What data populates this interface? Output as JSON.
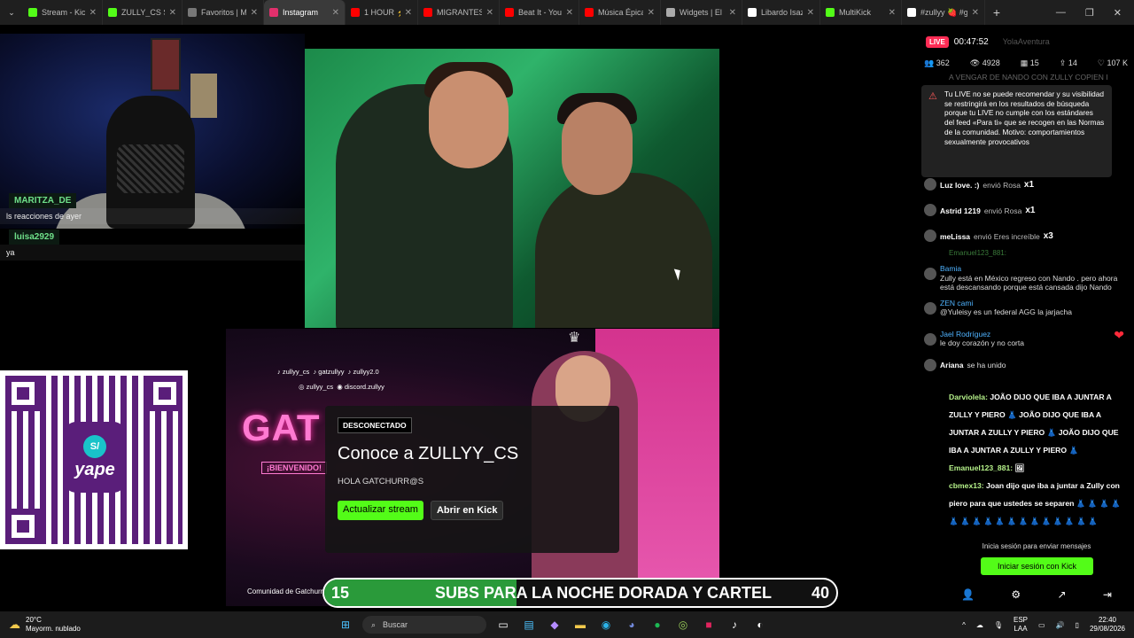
{
  "browser": {
    "tabs": [
      {
        "label": "Stream - Kick | (",
        "color": "#53fc18"
      },
      {
        "label": "ZULLY_CS Strea",
        "color": "#53fc18"
      },
      {
        "label": "Favoritos | My",
        "color": "#777777"
      },
      {
        "label": "Instagram",
        "color": "#e1306c",
        "active": true
      },
      {
        "label": "1 HOUR ⚡ VI",
        "color": "#ff0000"
      },
      {
        "label": "MIGRANTES f",
        "color": "#ff0000"
      },
      {
        "label": "Beat It - YouTu",
        "color": "#ff0000"
      },
      {
        "label": "Música Épica d",
        "color": "#ff0000"
      },
      {
        "label": "Widgets | El m",
        "color": "#aaaaaa"
      },
      {
        "label": "Libardo Isaza (",
        "color": "#ffffff"
      },
      {
        "label": "MultiKick",
        "color": "#53fc18"
      },
      {
        "label": "#zullyy 🍓 #ga",
        "color": "#ffffff"
      }
    ]
  },
  "overlay_chat": [
    {
      "user": "MARITZA_DE",
      "message": "ls reacciones de ayer"
    },
    {
      "user": "luisa2929",
      "message": "ya"
    }
  ],
  "offline_card": {
    "badge": "DESCONECTADO",
    "title": "Conoce a ZULLYY_CS",
    "subtitle": "HOLA GATCHURR@S",
    "update_button": "Actualizar stream",
    "open_button": "Abrir en Kick"
  },
  "banner": {
    "socials_row1": [
      "zullyy_cs",
      "gatzullyy",
      "zullyy2.0"
    ],
    "socials_row2": [
      "zullyy_cs",
      "discord.zullyy"
    ],
    "gat_text": "GAT",
    "welcome": "¡BIENVENIDO!",
    "community": "Comunidad de Gatchurr"
  },
  "qr": {
    "brand": "yape",
    "symbol": "S/"
  },
  "subs_goal": {
    "current": "15",
    "title": "SUBS PARA LA NOCHE DORADA Y CARTEL",
    "goal": "40",
    "progress": 0.375
  },
  "tiktok_panel": {
    "live_label": "LIVE",
    "timer": "00:47:52",
    "faint_user": "YolaAventura",
    "stats": [
      "362",
      "4928",
      "15",
      "14",
      "107 K"
    ],
    "ghost_line": "A VENGAR DE NANDO CON ZULLY COPIEN I",
    "warning": "Tu LIVE no se puede recomendar y su visibilidad se restringirá en los resultados de búsqueda porque tu LIVE no cumple con los estándares del feed «Para ti» que se recogen en las Normas de la comunidad. Motivo: comportamientos sexualmente provocativos",
    "gifts": [
      {
        "user": "Luz love. :)",
        "action": "envió Rosa",
        "mult": "x1"
      },
      {
        "user": "Astrid 1219",
        "action": "envió Rosa",
        "mult": "x1"
      },
      {
        "user": "meLissa",
        "action": "envió Eres increíble",
        "mult": "x3"
      }
    ],
    "ghost1": "Emanuel123_881:",
    "ghost2": "Emanuel123_881:",
    "comment1_user": "Bamia",
    "comment1_text": "Zully está en México regreso con Nando . pero ahora está descansando porque está cansada dijo Nando",
    "comment2_user": "cami",
    "comment2_tag": "ZEN",
    "comment2_text": "@Yuleisy es un federal AGG la jarjacha",
    "comment3_user": "Jael Rodríguez",
    "comment3_text": "le doy corazón y no corta",
    "join_user": "Ariana",
    "join_text": "se ha unido"
  },
  "kick_chat": [
    {
      "user": "Darviolela:",
      "text": "JOÃO DIJO QUE IBA A JUNTAR A ZULLY Y PIERO 👗 JOÃO DIJO QUE IBA A JUNTAR A ZULLY Y PIERO 👗 JOÃO DIJO QUE IBA A JUNTAR A ZULLY Y PIERO 👗"
    },
    {
      "user": "Emanuel123_881:",
      "text": "🖼"
    },
    {
      "user": "cbmex13:",
      "text": "Joan dijo que iba a juntar a Zully con piero para que ustedes se separen 👗 👗 👗 👗"
    },
    {
      "user": "",
      "text": "👗 👗 👗 👗 👗 👗 👗 👗 👗 👗 👗 👗 👗"
    }
  ],
  "kick_signin": {
    "text": "Inicia sesión para enviar mensajes",
    "button": "Iniciar sesión con Kick"
  },
  "taskbar": {
    "temp": "20°C",
    "weather": "Mayorm. nublado",
    "search": "Buscar",
    "lang1": "ESP",
    "lang2": "LAA",
    "time": "22:40",
    "date": "29/08/2026"
  }
}
